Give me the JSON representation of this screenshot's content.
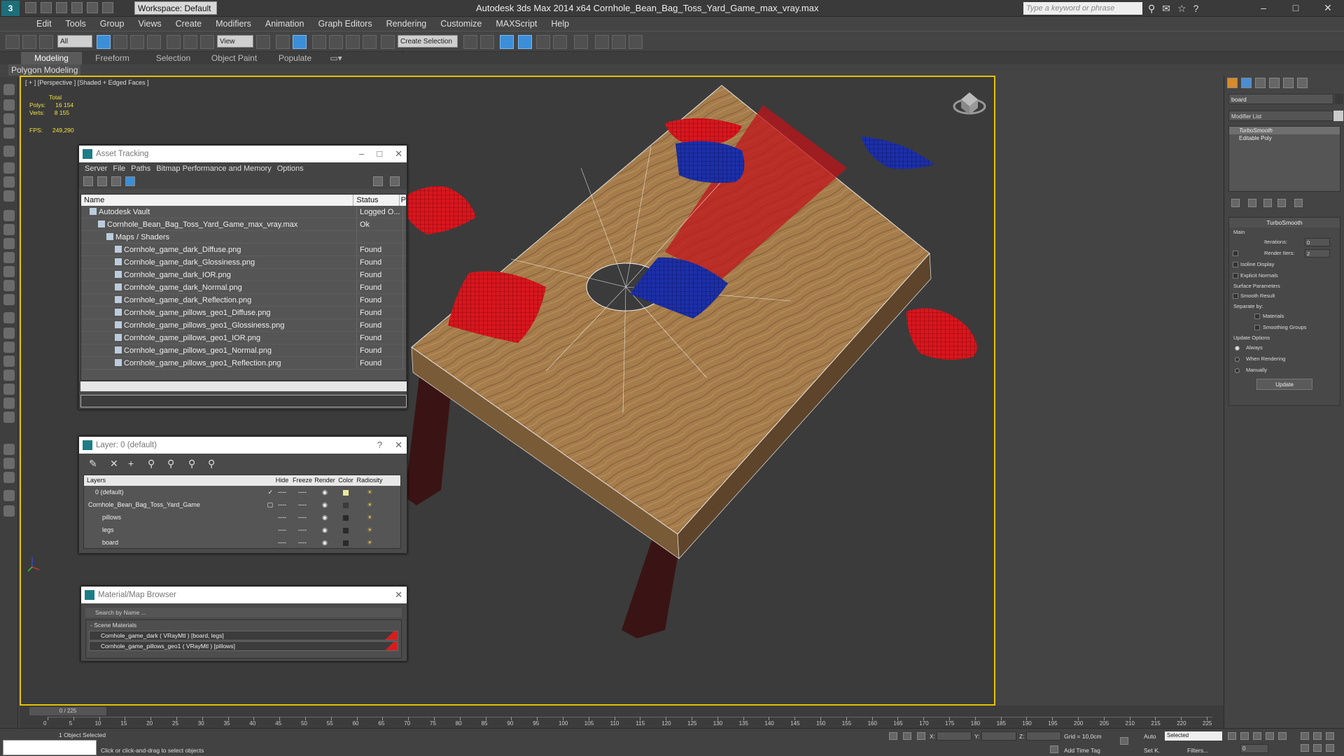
{
  "app": {
    "title": "Autodesk 3ds Max  2014 x64      Cornhole_Bean_Bag_Toss_Yard_Game_max_vray.max",
    "logo": "3",
    "workspace": "Workspace: Default",
    "search_placeholder": "Type a keyword or phrase",
    "window_controls": [
      "–",
      "□",
      "✕"
    ]
  },
  "menu": [
    "Edit",
    "Tools",
    "Group",
    "Views",
    "Create",
    "Modifiers",
    "Animation",
    "Graph Editors",
    "Rendering",
    "Customize",
    "MAXScript",
    "Help"
  ],
  "toolbar": {
    "filter": "All",
    "ref_coord": "View",
    "selection_set": "Create Selection S"
  },
  "ribbon": {
    "tabs": [
      "Modeling",
      "Freeform",
      "Selection",
      "Object Paint",
      "Populate"
    ],
    "active_tab": "Modeling",
    "subpanel": "Polygon Modeling"
  },
  "viewport": {
    "label": "[ + ] [Perspective ] [Shaded + Edged Faces ]",
    "stats": {
      "total_label": "Total",
      "polys_label": "Polys:",
      "polys": "16 154",
      "verts_label": "Verts:",
      "verts": "8 155",
      "fps_label": "FPS:",
      "fps": "249,290"
    }
  },
  "asset_tracking": {
    "title": "Asset Tracking",
    "menu": [
      "Server",
      "File",
      "Paths",
      "Bitmap Performance and Memory",
      "Options"
    ],
    "col_name": "Name",
    "col_status": "Status",
    "col_extra": "P",
    "rows": [
      {
        "name": "Autodesk Vault",
        "status": "Logged O...",
        "indent": 1
      },
      {
        "name": "Cornhole_Bean_Bag_Toss_Yard_Game_max_vray.max",
        "status": "Ok",
        "indent": 2
      },
      {
        "name": "Maps / Shaders",
        "status": "",
        "indent": 3
      },
      {
        "name": "Cornhole_game_dark_Diffuse.png",
        "status": "Found",
        "indent": 4
      },
      {
        "name": "Cornhole_game_dark_Glossiness.png",
        "status": "Found",
        "indent": 4
      },
      {
        "name": "Cornhole_game_dark_IOR.png",
        "status": "Found",
        "indent": 4
      },
      {
        "name": "Cornhole_game_dark_Normal.png",
        "status": "Found",
        "indent": 4
      },
      {
        "name": "Cornhole_game_dark_Reflection.png",
        "status": "Found",
        "indent": 4
      },
      {
        "name": "Cornhole_game_pillows_geo1_Diffuse.png",
        "status": "Found",
        "indent": 4
      },
      {
        "name": "Cornhole_game_pillows_geo1_Glossiness.png",
        "status": "Found",
        "indent": 4
      },
      {
        "name": "Cornhole_game_pillows_geo1_IOR.png",
        "status": "Found",
        "indent": 4
      },
      {
        "name": "Cornhole_game_pillows_geo1_Normal.png",
        "status": "Found",
        "indent": 4
      },
      {
        "name": "Cornhole_game_pillows_geo1_Reflection.png",
        "status": "Found",
        "indent": 4
      }
    ]
  },
  "layer_manager": {
    "title": "Layer: 0 (default)",
    "help": "?",
    "columns": [
      "Layers",
      "Hide",
      "Freeze",
      "Render",
      "Color",
      "Radiosity"
    ],
    "rows": [
      {
        "name": "0 (default)",
        "check": "✓",
        "color": "#e8e8a0",
        "indent": 1
      },
      {
        "name": "Cornhole_Bean_Bag_Toss_Yard_Game",
        "check": "▢",
        "color": "#3a3a3a",
        "indent": 0
      },
      {
        "name": "pillows",
        "check": "",
        "color": "#2a2a2a",
        "indent": 2
      },
      {
        "name": "legs",
        "check": "",
        "color": "#2a2a2a",
        "indent": 2
      },
      {
        "name": "board",
        "check": "",
        "color": "#2a2a2a",
        "indent": 2
      }
    ],
    "dash": "----"
  },
  "material_browser": {
    "title": "Material/Map Browser",
    "search_placeholder": "Search by Name ...",
    "group": "- Scene Materials",
    "materials": [
      "Cornhole_game_dark  ( VRayMtl ) [board, legs]",
      "Cornhole_game_pillows_geo1 ( VRayMtl ) [pillows]"
    ]
  },
  "command_panel": {
    "object_name": "board",
    "modifier_list": "Modifier List",
    "stack": [
      "TurboSmooth",
      "Editable Poly"
    ],
    "turbosmooth": {
      "title": "TurboSmooth",
      "main": "Main",
      "iterations_label": "Iterations:",
      "iterations": "0",
      "render_iters_label": "Render Iters:",
      "render_iters": "2",
      "isoline": "Isoline Display",
      "explicit": "Explicit Normals",
      "surface_params": "Surface Parameters",
      "smooth_result": "Smooth Result",
      "separate_by": "Separate by:",
      "materials": "Materials",
      "smoothing_groups": "Smoothing Groups",
      "update_options": "Update Options",
      "always": "Always",
      "when_rendering": "When Rendering",
      "manually": "Manually",
      "update_btn": "Update"
    }
  },
  "timeline": {
    "slider": "0 / 225",
    "ticks": [
      "0",
      "5",
      "10",
      "15",
      "20",
      "25",
      "30",
      "35",
      "40",
      "45",
      "50",
      "55",
      "60",
      "65",
      "70",
      "75",
      "80",
      "85",
      "90",
      "95",
      "100",
      "105",
      "110",
      "115",
      "120",
      "125",
      "130",
      "135",
      "140",
      "145",
      "150",
      "155",
      "160",
      "165",
      "170",
      "175",
      "180",
      "185",
      "190",
      "195",
      "200",
      "205",
      "210",
      "215",
      "220",
      "225"
    ]
  },
  "status": {
    "selected": "1 Object Selected",
    "prompt": "Click or click-and-drag to select objects",
    "x_label": "X:",
    "y_label": "Y:",
    "z_label": "Z:",
    "grid": "Grid = 10,0cm",
    "add_time_tag": "Add Time Tag",
    "auto": "Auto",
    "set_k": "Set K.",
    "selected_dd": "Selected",
    "filters": "Filters...",
    "frame": "0"
  },
  "colors": {
    "viewport_border": "#e3c200",
    "stats_text": "#f0e040",
    "bag_red": "#d8161e",
    "bag_blue": "#1c2fa8",
    "wood": "#a8804e",
    "legs": "#3a1414"
  }
}
